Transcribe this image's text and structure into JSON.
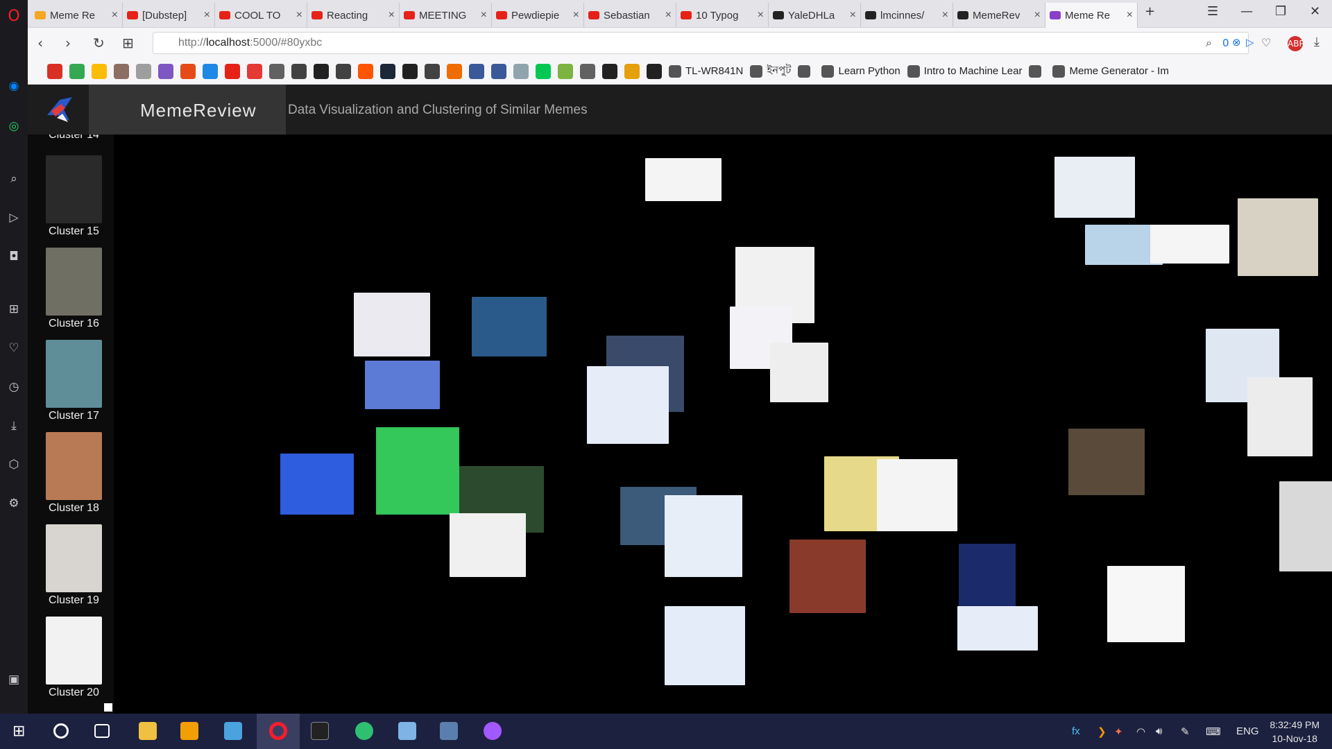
{
  "browser": {
    "tabs": [
      {
        "title": "Meme Re",
        "color": "#f5a623"
      },
      {
        "title": "[Dubstep]",
        "color": "#e62117"
      },
      {
        "title": "COOL TO",
        "color": "#e62117"
      },
      {
        "title": "Reacting",
        "color": "#e62117"
      },
      {
        "title": "MEETING",
        "color": "#e62117"
      },
      {
        "title": "Pewdiepie",
        "color": "#e62117"
      },
      {
        "title": "Sebastian",
        "color": "#e62117"
      },
      {
        "title": "10 Typog",
        "color": "#e62117"
      },
      {
        "title": "YaleDHLa",
        "color": "#222222"
      },
      {
        "title": "lmcinnes/",
        "color": "#222222"
      },
      {
        "title": "MemeRev",
        "color": "#222222"
      },
      {
        "title": "Meme Re",
        "color": "#8a3fc7",
        "active": true
      }
    ],
    "url_prefix": "http://",
    "url_host": "localhost",
    "url_rest": ":5000/#80yxbc",
    "adblock_count": "0",
    "bookmarks": [
      {
        "icon": "gmail-icon",
        "color": "#d93025"
      },
      {
        "icon": "drive-icon",
        "color": "#34a853"
      },
      {
        "icon": "photos-icon",
        "color": "#fbbc05"
      },
      {
        "icon": "avatar-icon",
        "color": "#8d6e63"
      },
      {
        "icon": "tools-icon",
        "color": "#9e9e9e"
      },
      {
        "icon": "j-icon",
        "color": "#7e57c2"
      },
      {
        "icon": "x-icon",
        "color": "#e64a19"
      },
      {
        "icon": "t-icon",
        "color": "#1e88e5"
      },
      {
        "icon": "youtube-icon",
        "color": "#e62117"
      },
      {
        "icon": "m-icon",
        "color": "#e53935"
      },
      {
        "icon": "inkscape-icon",
        "color": "#616161"
      },
      {
        "icon": "a-icon",
        "color": "#424242"
      },
      {
        "icon": "psd-icon",
        "color": "#212121"
      },
      {
        "icon": "bolt-icon",
        "color": "#424242"
      },
      {
        "icon": "soundcloud-icon",
        "color": "#ff5500"
      },
      {
        "icon": "steam-icon",
        "color": "#1b2838"
      },
      {
        "icon": "unity-icon",
        "color": "#212121"
      },
      {
        "icon": "send-icon",
        "color": "#424242"
      },
      {
        "icon": "house-icon",
        "color": "#ef6c00"
      },
      {
        "icon": "facebook-icon",
        "color": "#3b5998"
      },
      {
        "icon": "facebook-icon",
        "color": "#3b5998"
      },
      {
        "icon": "cloud-icon",
        "color": "#90a4ae"
      },
      {
        "icon": "play-store-icon",
        "color": "#00c853"
      },
      {
        "icon": "leaf-icon",
        "color": "#7cb342"
      },
      {
        "icon": "star-icon",
        "color": "#616161"
      },
      {
        "icon": "s-icon",
        "color": "#212121"
      },
      {
        "icon": "plex-icon",
        "color": "#e5a00d"
      },
      {
        "icon": "pause-icon",
        "color": "#212121"
      }
    ],
    "bookmark_links": [
      {
        "label": "TL-WR841N",
        "icon": "doc-icon"
      },
      {
        "label": "ইনপুট",
        "icon": "google-icon"
      },
      {
        "label": "",
        "icon": "google-icon"
      },
      {
        "label": "Learn Python",
        "icon": "datacamp-icon"
      },
      {
        "label": "Intro to Machine Lear",
        "icon": "udacity-icon"
      },
      {
        "label": "",
        "icon": "github-icon"
      },
      {
        "label": "Meme Generator - Im",
        "icon": "imgflip-icon"
      }
    ]
  },
  "app": {
    "brand": "MemeReview",
    "page_title": "Data Visualization and Clustering of Similar Memes",
    "clusters": [
      {
        "label": "Cluster 15",
        "color": "#2a2a2a"
      },
      {
        "label": "Cluster 16",
        "color": "#6f6f63"
      },
      {
        "label": "Cluster 17",
        "color": "#5f8e99"
      },
      {
        "label": "Cluster 18",
        "color": "#b87a55"
      },
      {
        "label": "Cluster 19",
        "color": "#d8d4d0"
      },
      {
        "label": "Cluster 20",
        "color": "#f2f2f2"
      }
    ],
    "partial_cluster_label": "Cluster 14"
  },
  "memes": [
    {
      "name": "google-screenshot",
      "color": "#f4f4f4"
    },
    {
      "name": "chat-screenshot",
      "color": "#e9eef5"
    },
    {
      "name": "map-screenshot",
      "color": "#b9d3e8"
    },
    {
      "name": "text-screenshot",
      "color": "#f1f1f1"
    },
    {
      "name": "this-is-high-meme",
      "color": "#d8d2c4"
    },
    {
      "name": "tweet-screenshot",
      "color": "#f5f5f5"
    },
    {
      "name": "blockbuster-meme",
      "color": "#eaeaf0"
    },
    {
      "name": "orange-card-meme",
      "color": "#2a5a8a"
    },
    {
      "name": "chat-screenshot",
      "color": "#f3f3f7"
    },
    {
      "name": "google-logo",
      "color": "#eeeeee"
    },
    {
      "name": "usb-meme",
      "color": "#5c7bd6"
    },
    {
      "name": "imessage-screenshot",
      "color": "#dfe7f3"
    },
    {
      "name": "ajit-pai-meme",
      "color": "#3a4a6a"
    },
    {
      "name": "chat-screenshot",
      "color": "#e6edf8"
    },
    {
      "name": "chat-screenshot",
      "color": "#ececec"
    },
    {
      "name": "blue-bubble-meme",
      "color": "#2f5de0"
    },
    {
      "name": "green-bubble-meme",
      "color": "#34c759"
    },
    {
      "name": "game-screenshot",
      "color": "#2c4a2e"
    },
    {
      "name": "chat-screenshot",
      "color": "#f0f0f0"
    },
    {
      "name": "score-100-meme",
      "color": "#3c5a7a"
    },
    {
      "name": "yellow-paper-meme",
      "color": "#e6d98a"
    },
    {
      "name": "explosion-100-meme",
      "color": "#8a3a2a"
    },
    {
      "name": "dark-phone-meme",
      "color": "#1a2a6a"
    },
    {
      "name": "security-question-meme",
      "color": "#f7f7f7"
    },
    {
      "name": "chat-screenshot",
      "color": "#e8eef8"
    },
    {
      "name": "score-100-chat",
      "color": "#e3ecf8"
    },
    {
      "name": "face-photo-meme",
      "color": "#5a4a3a"
    },
    {
      "name": "chat-screenshot",
      "color": "#f4f4f4"
    },
    {
      "name": "chat-screenshot",
      "color": "#e6edf8"
    },
    {
      "name": "partial-meme",
      "color": "#d9d9d9"
    }
  ],
  "system": {
    "tray_lang": "ENG",
    "time": "8:32:49 PM",
    "date": "10-Nov-18"
  }
}
